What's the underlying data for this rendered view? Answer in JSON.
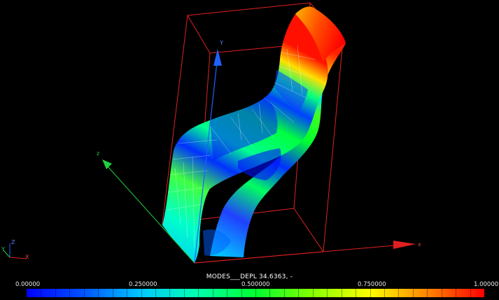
{
  "viewer": {
    "axes": {
      "y_label": "Y",
      "x_label": "x",
      "z_label": "z"
    },
    "triad": {
      "z": "Z",
      "y": "Y",
      "x": "X"
    },
    "colorbar": {
      "title": "MODES___DEPL 34.6363, -",
      "ticks": [
        "0.00000",
        "0.250000",
        "0.500000",
        "0.750000",
        "1.00000"
      ],
      "range": [
        0,
        1
      ],
      "colors": [
        "#0000ff",
        "#00c8ff",
        "#00ff30",
        "#ffff00",
        "#ff0000"
      ]
    },
    "colors": {
      "bounding_box": "#e02020",
      "axis_y": "#2060ff",
      "axis_z": "#20d040",
      "axis_x": "#e02020",
      "background": "#000000"
    },
    "icons": [
      "axis-arrow-icon",
      "triad-icon"
    ]
  }
}
